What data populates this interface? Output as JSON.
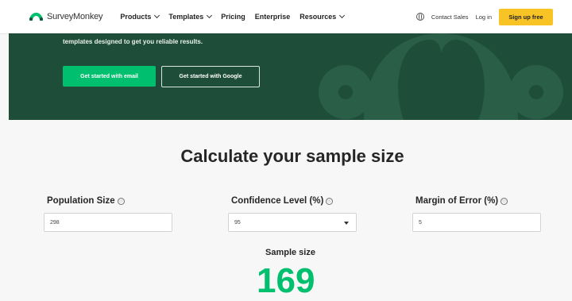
{
  "nav": {
    "logo_text": "SurveyMonkey",
    "items": [
      {
        "label": "Products",
        "has_dropdown": true
      },
      {
        "label": "Templates",
        "has_dropdown": true
      },
      {
        "label": "Pricing",
        "has_dropdown": false
      },
      {
        "label": "Enterprise",
        "has_dropdown": false
      },
      {
        "label": "Resources",
        "has_dropdown": true
      }
    ],
    "contact_sales": "Contact Sales",
    "login": "Log in",
    "signup": "Sign up free",
    "signup_color": "#f7c325"
  },
  "hero": {
    "background": "#1e4d3a",
    "text_line": "templates designed to get you reliable results.",
    "btn_primary": "Get started with email",
    "btn_secondary": "Get started with Google",
    "primary_color": "#00bf6f"
  },
  "calculator": {
    "title": "Calculate your sample size",
    "population_label": "Population Size",
    "population_value": "298",
    "confidence_label": "Confidence Level (%)",
    "confidence_value": "95",
    "margin_label": "Margin of Error (%)",
    "margin_value": "5",
    "info_icon": "ⓘ",
    "sample_label": "Sample size",
    "sample_value": "169",
    "accent_color": "#00bf6f"
  }
}
